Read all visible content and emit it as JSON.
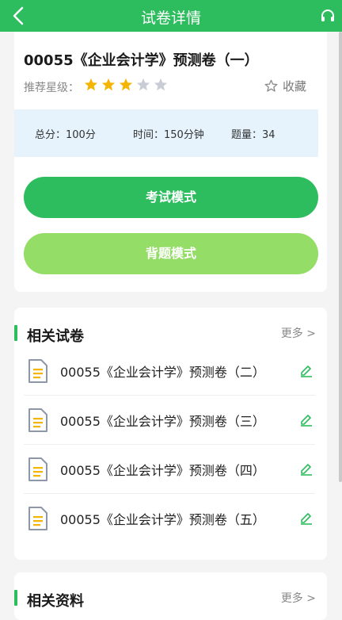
{
  "topbar": {
    "title": "试卷详情"
  },
  "exam": {
    "title": "00055《企业会计学》预测卷（一）",
    "rating_label": "推荐星级：",
    "rating": 3,
    "rating_max": 5,
    "favorite_label": "收藏",
    "info": {
      "total_score": "总分：100分",
      "time": "时间：150分钟",
      "question_count": "题量：34"
    },
    "exam_mode_label": "考试模式",
    "recite_mode_label": "背题模式"
  },
  "related_papers": {
    "title": "相关试卷",
    "more": "更多 >",
    "items": [
      {
        "label": "00055《企业会计学》预测卷（二）"
      },
      {
        "label": "00055《企业会计学》预测卷（三）"
      },
      {
        "label": "00055《企业会计学》预测卷（四）"
      },
      {
        "label": "00055《企业会计学》预测卷（五）"
      }
    ]
  },
  "related_materials": {
    "title": "相关资料",
    "more": "更多 >"
  },
  "colors": {
    "primary": "#2dbd5e",
    "secondary": "#94dd66",
    "star_active": "#f5b400",
    "star_inactive": "#c8ccd4",
    "info_bg": "#e6f3fc"
  }
}
